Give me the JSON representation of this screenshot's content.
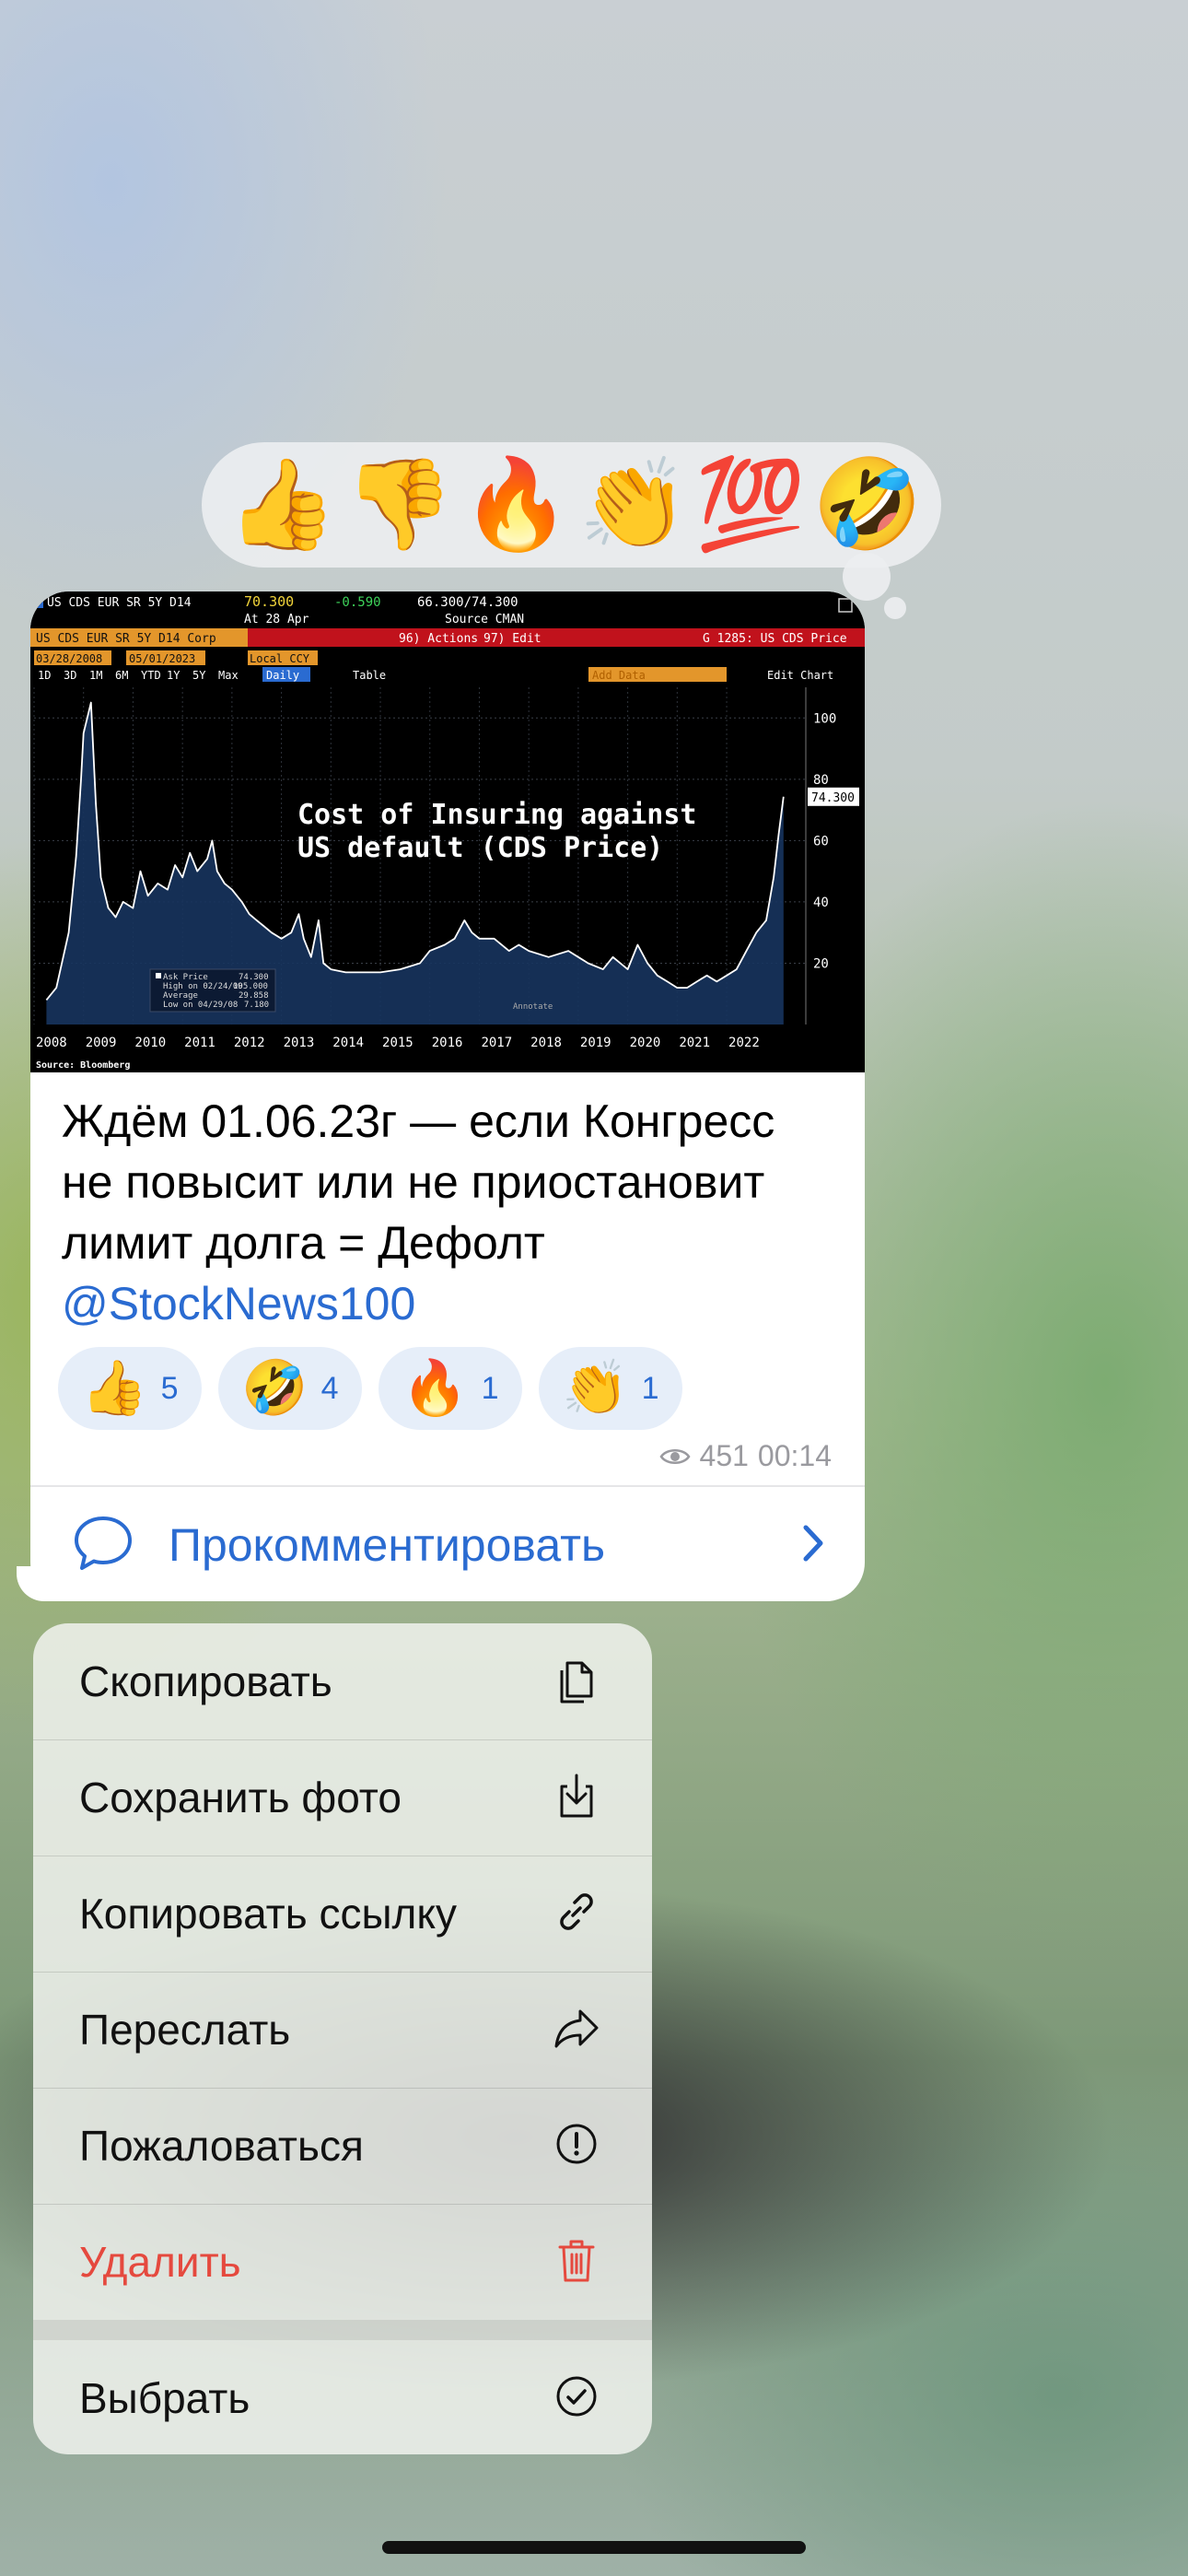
{
  "reaction_picker": {
    "emojis": [
      "👍",
      "👎",
      "🔥",
      "👏",
      "💯",
      "🤣"
    ]
  },
  "message": {
    "photo": {
      "header": {
        "ticker": "US CDS EUR SR 5Y D14",
        "price": "70.300",
        "change": "-0.590",
        "range": "66.300/74.300",
        "date": "At 28 Apr",
        "source": "Source CMAN",
        "bar_ticker": "US CDS EUR SR 5Y D14 Corp",
        "actions": "96) Actions",
        "edit": "97) Edit",
        "gcode": "G 1285: US CDS Price",
        "date_from": "03/28/2008",
        "date_to": "05/01/2023",
        "currency": "Local CCY",
        "periods": [
          "1D",
          "3D",
          "1M",
          "6M",
          "YTD",
          "1Y",
          "5Y",
          "Max"
        ],
        "frequency": "Daily",
        "table": "Table",
        "add_data": "Add Data",
        "edit_chart": "Edit Chart",
        "source_note": "Source: Bloomberg"
      },
      "legend": {
        "ask": "Ask Price",
        "ask_val": "74.300",
        "high": "High on 02/24/09",
        "high_val": "105.000",
        "avg": "Average",
        "avg_val": "29.858",
        "low": "Low on 04/29/08",
        "low_val": "7.180",
        "annotate": "Annotate"
      }
    },
    "chart_data": {
      "type": "area",
      "title": "Cost of Insuring against US default (CDS Price)",
      "x_ticks": [
        "2008",
        "2009",
        "2010",
        "2011",
        "2012",
        "2013",
        "2014",
        "2015",
        "2016",
        "2017",
        "2018",
        "2019",
        "2020",
        "2021",
        "2022"
      ],
      "y_ticks": [
        20,
        40,
        60,
        80,
        100
      ],
      "ylim": [
        0,
        110
      ],
      "last_value_label": "74.300",
      "series": [
        {
          "points": [
            [
              2008.25,
              8
            ],
            [
              2008.45,
              12
            ],
            [
              2008.7,
              30
            ],
            [
              2008.85,
              55
            ],
            [
              2008.95,
              80
            ],
            [
              2009.0,
              95
            ],
            [
              2009.15,
              105
            ],
            [
              2009.25,
              72
            ],
            [
              2009.35,
              48
            ],
            [
              2009.5,
              38
            ],
            [
              2009.65,
              35
            ],
            [
              2009.8,
              40
            ],
            [
              2010.0,
              38
            ],
            [
              2010.15,
              50
            ],
            [
              2010.3,
              42
            ],
            [
              2010.5,
              46
            ],
            [
              2010.7,
              44
            ],
            [
              2010.85,
              52
            ],
            [
              2011.0,
              48
            ],
            [
              2011.15,
              56
            ],
            [
              2011.3,
              50
            ],
            [
              2011.5,
              54
            ],
            [
              2011.6,
              60
            ],
            [
              2011.7,
              50
            ],
            [
              2011.85,
              46
            ],
            [
              2012.0,
              44
            ],
            [
              2012.2,
              40
            ],
            [
              2012.35,
              36
            ],
            [
              2012.5,
              34
            ],
            [
              2012.65,
              32
            ],
            [
              2012.8,
              30
            ],
            [
              2013.0,
              28
            ],
            [
              2013.2,
              30
            ],
            [
              2013.35,
              36
            ],
            [
              2013.45,
              28
            ],
            [
              2013.6,
              22
            ],
            [
              2013.75,
              34
            ],
            [
              2013.85,
              20
            ],
            [
              2014.0,
              18
            ],
            [
              2014.3,
              17
            ],
            [
              2014.6,
              17
            ],
            [
              2015.0,
              17
            ],
            [
              2015.4,
              18
            ],
            [
              2015.8,
              20
            ],
            [
              2016.0,
              24
            ],
            [
              2016.3,
              26
            ],
            [
              2016.5,
              28
            ],
            [
              2016.7,
              34
            ],
            [
              2016.85,
              30
            ],
            [
              2017.0,
              28
            ],
            [
              2017.3,
              28
            ],
            [
              2017.6,
              24
            ],
            [
              2017.8,
              26
            ],
            [
              2018.0,
              24
            ],
            [
              2018.4,
              22
            ],
            [
              2018.8,
              24
            ],
            [
              2019.0,
              22
            ],
            [
              2019.2,
              20
            ],
            [
              2019.5,
              18
            ],
            [
              2019.7,
              22
            ],
            [
              2020.0,
              18
            ],
            [
              2020.2,
              26
            ],
            [
              2020.4,
              20
            ],
            [
              2020.6,
              16
            ],
            [
              2020.8,
              14
            ],
            [
              2021.0,
              12
            ],
            [
              2021.2,
              12
            ],
            [
              2021.4,
              14
            ],
            [
              2021.6,
              16
            ],
            [
              2021.8,
              14
            ],
            [
              2022.0,
              16
            ],
            [
              2022.2,
              18
            ],
            [
              2022.4,
              24
            ],
            [
              2022.6,
              30
            ],
            [
              2022.8,
              34
            ],
            [
              2022.95,
              48
            ],
            [
              2023.05,
              62
            ],
            [
              2023.15,
              74.3
            ]
          ]
        }
      ]
    },
    "text_lines": [
      "Ждём 01.06.23г — если Конгресс",
      "не повысит или не приостановит",
      "лимит долга = Дефолт"
    ],
    "mention": "@StockNews100",
    "reactions": [
      {
        "emoji": "👍",
        "count": "5"
      },
      {
        "emoji": "🤣",
        "count": "4"
      },
      {
        "emoji": "🔥",
        "count": "1"
      },
      {
        "emoji": "👏",
        "count": "1"
      }
    ],
    "views": "451",
    "time": "00:14",
    "comment_label": "Прокомментировать"
  },
  "menu": {
    "items": [
      {
        "label": "Скопировать",
        "icon": "copy-icon"
      },
      {
        "label": "Сохранить фото",
        "icon": "save-photo-icon"
      },
      {
        "label": "Копировать ссылку",
        "icon": "link-icon"
      },
      {
        "label": "Переслать",
        "icon": "forward-icon"
      },
      {
        "label": "Пожаловаться",
        "icon": "report-icon"
      },
      {
        "label": "Удалить",
        "icon": "trash-icon"
      },
      {
        "label": "Выбрать",
        "icon": "select-check-icon"
      }
    ]
  },
  "colors": {
    "accent": "#2a6bd1",
    "danger": "#e5493e"
  }
}
